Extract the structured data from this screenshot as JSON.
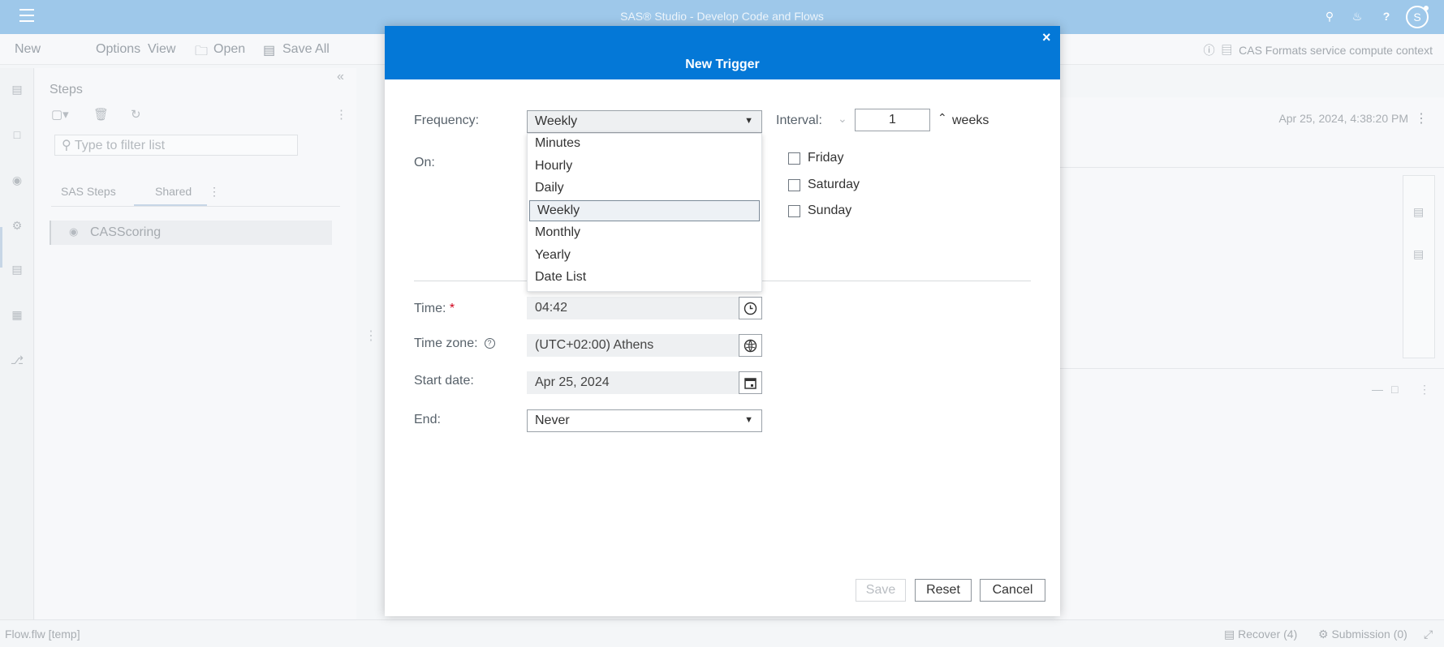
{
  "app": {
    "title": "SAS® Studio - Develop Code and Flows",
    "user_initial": "S"
  },
  "menubar": {
    "new": "New",
    "options": "Options",
    "view": "View",
    "open": "Open",
    "save_all": "Save All",
    "context": "CAS Formats service compute context"
  },
  "steps_pane": {
    "title": "Steps",
    "filter_placeholder": "Type to filter list",
    "tabs": [
      "SAS Steps",
      "Shared"
    ],
    "items": [
      "CASScoring"
    ]
  },
  "canvas": {
    "timestamp": "Apr 25, 2024, 4:38:20 PM"
  },
  "statusbar": {
    "file": "Flow.flw [temp]",
    "recover": "Recover (4)",
    "submission": "Submission (0)"
  },
  "modal": {
    "title": "New Trigger",
    "close": "×",
    "frequency_label": "Frequency:",
    "frequency_value": "Weekly",
    "frequency_options": [
      "Minutes",
      "Hourly",
      "Daily",
      "Weekly",
      "Monthly",
      "Yearly",
      "Date List"
    ],
    "frequency_selected_index": 3,
    "interval_label": "Interval:",
    "interval_value": "1",
    "interval_unit": "weeks",
    "on_label": "On:",
    "days": [
      {
        "label": "Friday",
        "checked": false
      },
      {
        "label": "Saturday",
        "checked": false
      },
      {
        "label": "Sunday",
        "checked": false
      }
    ],
    "time_label": "Time:",
    "time_required": "*",
    "time_value": "04:42",
    "timezone_label": "Time zone:",
    "timezone_value": "(UTC+02:00) Athens",
    "start_date_label": "Start date:",
    "start_date_value": "Apr 25, 2024",
    "end_label": "End:",
    "end_value": "Never",
    "buttons": {
      "save": "Save",
      "reset": "Reset",
      "cancel": "Cancel"
    }
  },
  "colors": {
    "header_blue": "#0478d7",
    "topbar_blue": "#9ec8ea"
  }
}
